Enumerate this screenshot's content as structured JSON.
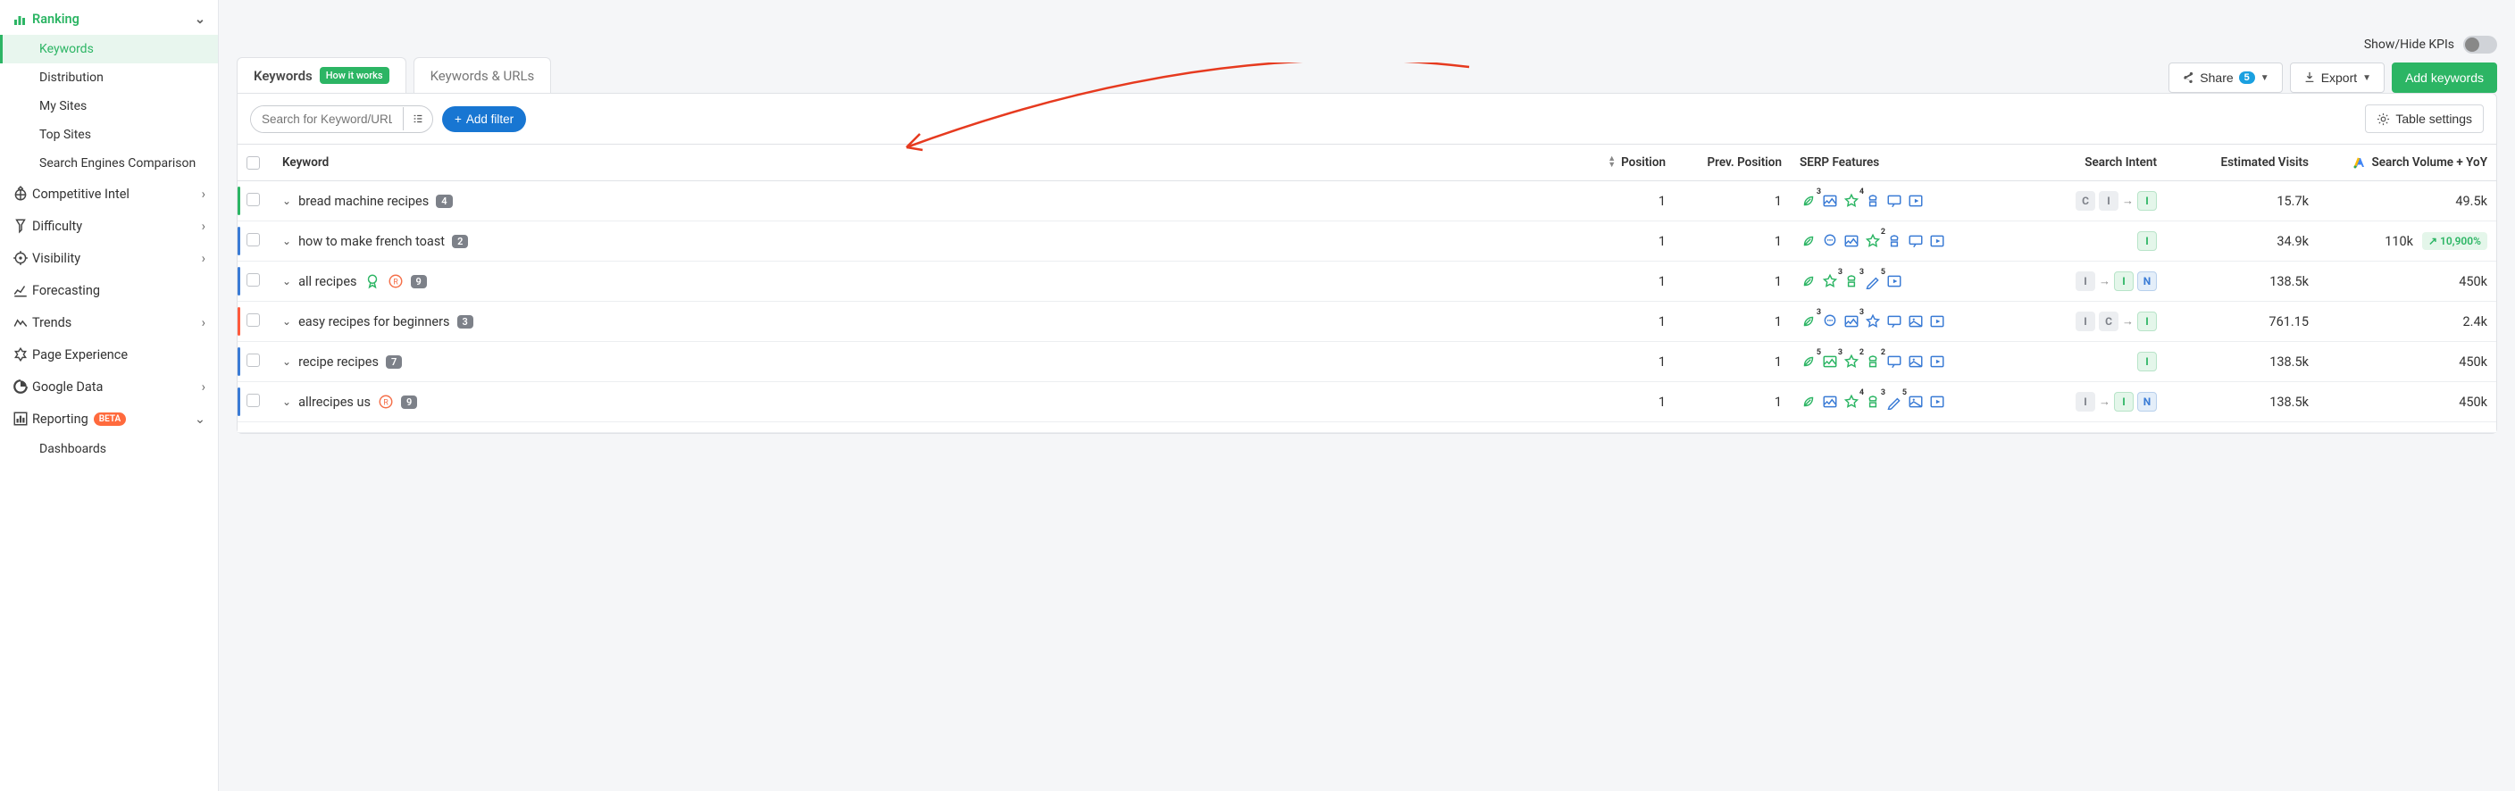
{
  "sidebar": {
    "ranking_label": "Ranking",
    "ranking_children": [
      {
        "label": "Keywords"
      },
      {
        "label": "Distribution"
      },
      {
        "label": "My Sites"
      },
      {
        "label": "Top Sites"
      },
      {
        "label": "Search Engines Comparison"
      }
    ],
    "items": [
      {
        "label": "Competitive Intel"
      },
      {
        "label": "Difficulty"
      },
      {
        "label": "Visibility"
      },
      {
        "label": "Forecasting"
      },
      {
        "label": "Trends"
      },
      {
        "label": "Page Experience"
      },
      {
        "label": "Google Data"
      },
      {
        "label": "Reporting",
        "beta": "BETA"
      }
    ],
    "reporting_children": [
      {
        "label": "Dashboards"
      }
    ]
  },
  "top": {
    "toggle_label": "Show/Hide KPIs"
  },
  "tabs": {
    "active": "Keywords",
    "how": "How it works",
    "other": "Keywords & URLs"
  },
  "toolbar": {
    "share": "Share",
    "share_count": "5",
    "export": "Export",
    "add": "Add keywords",
    "search_ph": "Search for Keyword/URL",
    "add_filter": "Add filter",
    "table_settings": "Table settings"
  },
  "headers": {
    "keyword": "Keyword",
    "position": "Position",
    "prev": "Prev. Position",
    "serp": "SERP Features",
    "intent": "Search Intent",
    "visits": "Estimated Visits",
    "volume": "Search Volume + YoY"
  },
  "rows": [
    {
      "kw": "bread machine recipes",
      "badge": "4",
      "pos": "1",
      "prev": "1",
      "serp": [
        {
          "t": "leaf",
          "c": "g",
          "sup": "3"
        },
        {
          "t": "img",
          "c": "b"
        },
        {
          "t": "star",
          "c": "g",
          "sup": "4"
        },
        {
          "t": "chef",
          "c": "b"
        },
        {
          "t": "qa",
          "c": "b"
        },
        {
          "t": "video",
          "c": "b"
        }
      ],
      "intent": [
        {
          "k": "C",
          "s": "gray"
        },
        {
          "k": "I",
          "s": "gray"
        },
        {
          "arrow": true
        },
        {
          "k": "I",
          "s": "green"
        }
      ],
      "visits": "15.7k",
      "vol": "49.5k",
      "yoy": null,
      "bar": "green",
      "award": false,
      "brand": false
    },
    {
      "kw": "how to make french toast",
      "badge": "2",
      "pos": "1",
      "prev": "1",
      "serp": [
        {
          "t": "leaf",
          "c": "g"
        },
        {
          "t": "chat",
          "c": "b"
        },
        {
          "t": "img",
          "c": "b"
        },
        {
          "t": "star",
          "c": "g",
          "sup": "2"
        },
        {
          "t": "chef",
          "c": "b"
        },
        {
          "t": "qa",
          "c": "b"
        },
        {
          "t": "video",
          "c": "b"
        }
      ],
      "intent": [
        {
          "k": "I",
          "s": "green"
        }
      ],
      "visits": "34.9k",
      "vol": "110k",
      "yoy": "10,900%",
      "bar": "blue",
      "award": false,
      "brand": false
    },
    {
      "kw": "all recipes",
      "badge": "9",
      "pos": "1",
      "prev": "1",
      "serp": [
        {
          "t": "leaf",
          "c": "g"
        },
        {
          "t": "star",
          "c": "g",
          "sup": "3"
        },
        {
          "t": "chef",
          "c": "g",
          "sup": "3"
        },
        {
          "t": "pen",
          "c": "b",
          "sup": "5"
        },
        {
          "t": "video",
          "c": "b"
        }
      ],
      "intent": [
        {
          "k": "I",
          "s": "gray"
        },
        {
          "arrow": true
        },
        {
          "k": "I",
          "s": "green"
        },
        {
          "k": "N",
          "s": "blue"
        }
      ],
      "visits": "138.5k",
      "vol": "450k",
      "yoy": null,
      "bar": "blue",
      "award": true,
      "brand": true
    },
    {
      "kw": "easy recipes for beginners",
      "badge": "3",
      "pos": "1",
      "prev": "1",
      "serp": [
        {
          "t": "leaf",
          "c": "g",
          "sup": "3"
        },
        {
          "t": "chat",
          "c": "b"
        },
        {
          "t": "img",
          "c": "b",
          "sup": "3"
        },
        {
          "t": "star",
          "c": "b"
        },
        {
          "t": "qa",
          "c": "b"
        },
        {
          "t": "pic",
          "c": "b"
        },
        {
          "t": "video",
          "c": "b"
        }
      ],
      "intent": [
        {
          "k": "I",
          "s": "gray"
        },
        {
          "k": "C",
          "s": "gray"
        },
        {
          "arrow": true
        },
        {
          "k": "I",
          "s": "green"
        }
      ],
      "visits": "761.15",
      "vol": "2.4k",
      "yoy": null,
      "bar": "orange",
      "award": false,
      "brand": false
    },
    {
      "kw": "recipe recipes",
      "badge": "7",
      "pos": "1",
      "prev": "1",
      "serp": [
        {
          "t": "leaf",
          "c": "g",
          "sup": "5"
        },
        {
          "t": "img",
          "c": "g",
          "sup": "3"
        },
        {
          "t": "star",
          "c": "g",
          "sup": "2"
        },
        {
          "t": "chef",
          "c": "g",
          "sup": "2"
        },
        {
          "t": "qa",
          "c": "b"
        },
        {
          "t": "pic",
          "c": "b"
        },
        {
          "t": "video",
          "c": "b"
        }
      ],
      "intent": [
        {
          "k": "I",
          "s": "green"
        }
      ],
      "visits": "138.5k",
      "vol": "450k",
      "yoy": null,
      "bar": "blue",
      "award": false,
      "brand": false
    },
    {
      "kw": "allrecipes us",
      "badge": "9",
      "pos": "1",
      "prev": "1",
      "serp": [
        {
          "t": "leaf",
          "c": "g"
        },
        {
          "t": "img",
          "c": "b"
        },
        {
          "t": "star",
          "c": "g",
          "sup": "4"
        },
        {
          "t": "chef",
          "c": "g",
          "sup": "3"
        },
        {
          "t": "pen",
          "c": "b",
          "sup": "5"
        },
        {
          "t": "pic",
          "c": "b"
        },
        {
          "t": "video",
          "c": "b"
        }
      ],
      "intent": [
        {
          "k": "I",
          "s": "gray"
        },
        {
          "arrow": true
        },
        {
          "k": "I",
          "s": "green"
        },
        {
          "k": "N",
          "s": "blue"
        }
      ],
      "visits": "138.5k",
      "vol": "450k",
      "yoy": null,
      "bar": "blue",
      "award": false,
      "brand": true
    }
  ]
}
